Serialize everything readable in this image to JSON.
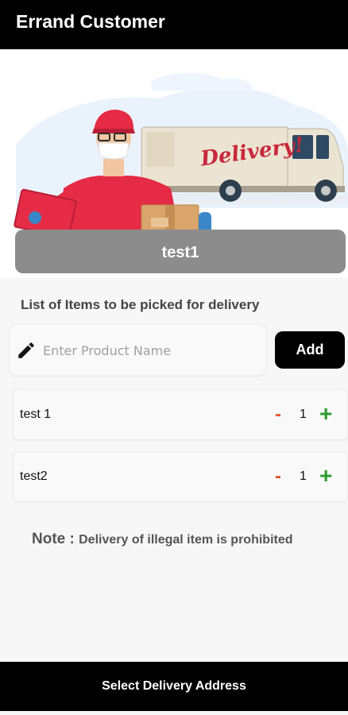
{
  "appbar": {
    "title": "Errand Customer"
  },
  "store": {
    "name": "test1"
  },
  "hero": {
    "truck_text": "Delivery!"
  },
  "items_section": {
    "title": "List of Items to be picked for delivery"
  },
  "product_input": {
    "placeholder": "Enter Product Name",
    "value": ""
  },
  "add_button": {
    "label": "Add"
  },
  "items": [
    {
      "name": "test 1",
      "quantity": "1",
      "minus": "-",
      "plus": "+"
    },
    {
      "name": "test2",
      "quantity": "1",
      "minus": "-",
      "plus": "+"
    }
  ],
  "note": {
    "label": "Note : ",
    "text": "Delivery of illegal item is prohibited"
  },
  "footer": {
    "action_label": "Select Delivery Address"
  },
  "colors": {
    "appbar": "#000000",
    "banner": "#8c8c8c",
    "minus": "#e4572e",
    "plus": "#2e9b2e",
    "truck_script": "#c8283c",
    "courier_shirt": "#e52b45"
  }
}
